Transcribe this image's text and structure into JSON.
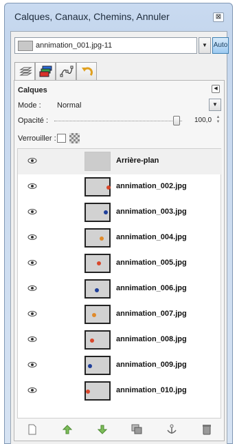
{
  "window": {
    "title": "Calques, Canaux, Chemins, Annuler",
    "close_label": "⊠"
  },
  "image_selector": {
    "value": "annimation_001.jpg-11",
    "auto_label": "Auto"
  },
  "tabs": [
    {
      "icon": "layers-icon"
    },
    {
      "icon": "channels-icon"
    },
    {
      "icon": "paths-icon"
    },
    {
      "icon": "undo-history-icon"
    }
  ],
  "panel": {
    "title": "Calques",
    "mode_label": "Mode :",
    "mode_value": "Normal",
    "opacity_label": "Opacité :",
    "opacity_value": "100,0",
    "opacity_fraction": 1.0,
    "lock_label": "Verrouiller :"
  },
  "layers": [
    {
      "name": "Arrière-plan",
      "selected": true
    },
    {
      "name": "annimation_002.jpg"
    },
    {
      "name": "annimation_003.jpg"
    },
    {
      "name": "annimation_004.jpg"
    },
    {
      "name": "annimation_005.jpg"
    },
    {
      "name": "annimation_006.jpg"
    },
    {
      "name": "annimation_007.jpg"
    },
    {
      "name": "annimation_008.jpg"
    },
    {
      "name": "annimation_009.jpg"
    },
    {
      "name": "annimation_010.jpg"
    }
  ],
  "bottom_actions": [
    {
      "icon": "new-layer-icon"
    },
    {
      "icon": "raise-layer-icon"
    },
    {
      "icon": "lower-layer-icon"
    },
    {
      "icon": "duplicate-layer-icon"
    },
    {
      "icon": "anchor-layer-icon"
    },
    {
      "icon": "delete-layer-icon"
    }
  ],
  "colors": {
    "accent": "#3c7fb1",
    "ball_red": "#d9472b",
    "ball_blue": "#1f3f9a",
    "ball_orange": "#e08a2a"
  }
}
